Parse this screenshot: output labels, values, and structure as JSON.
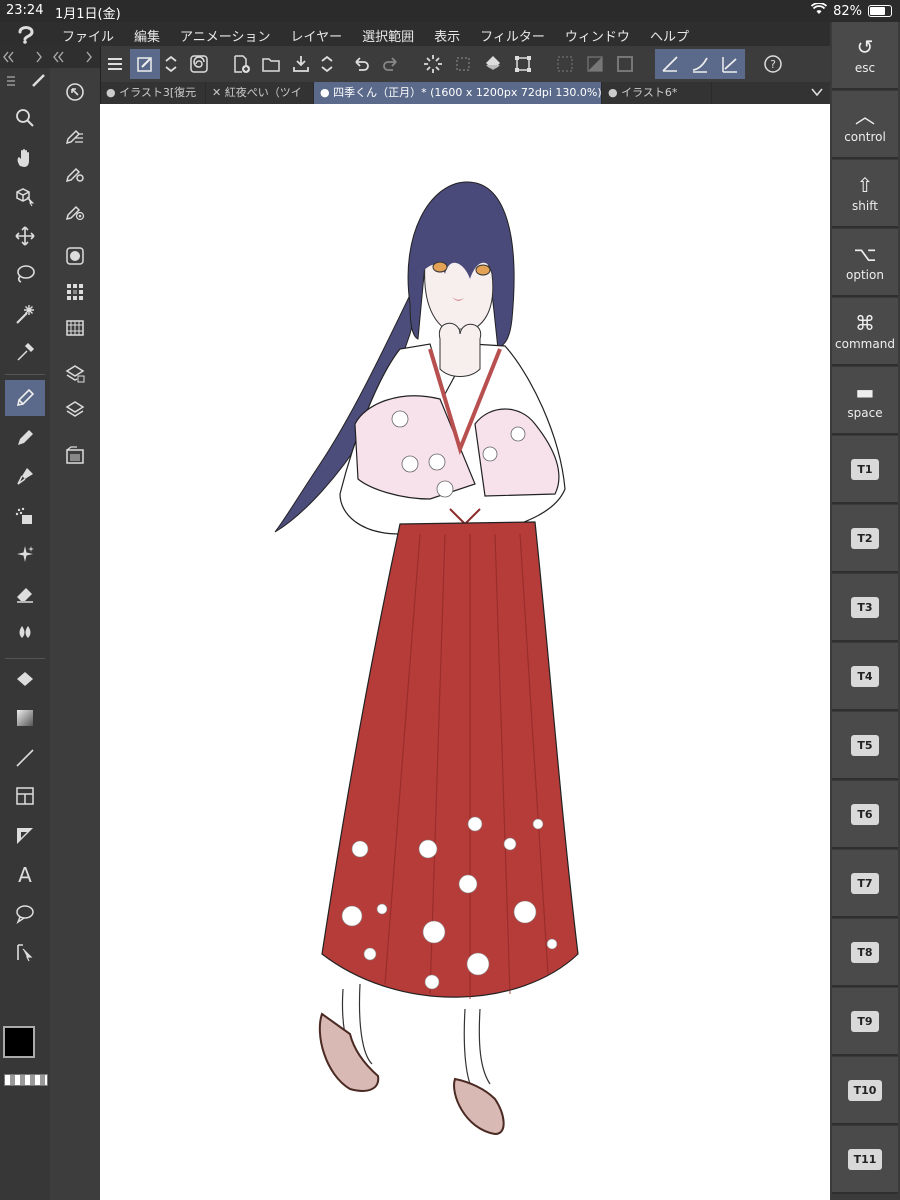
{
  "status": {
    "time": "23:24",
    "date": "1月1日(金)",
    "battery": "82%"
  },
  "menu": [
    "ファイル",
    "編集",
    "アニメーション",
    "レイヤー",
    "選択範囲",
    "表示",
    "フィルター",
    "ウィンドウ",
    "ヘルプ"
  ],
  "tabs": [
    {
      "label": "● イラスト3[復元",
      "active": false
    },
    {
      "label": "✕ 紅夜ぺい（ツイ",
      "active": false
    },
    {
      "label": "● 四季くん（正月）* (1600 x 1200px 72dpi 130.0%)",
      "active": true
    },
    {
      "label": "● イラスト6*",
      "active": false
    }
  ],
  "modifier_keys": [
    {
      "glyph": "↺",
      "label": "esc"
    },
    {
      "glyph": "︿",
      "label": "control"
    },
    {
      "glyph": "⇧",
      "label": "shift"
    },
    {
      "glyph": "⌥",
      "label": "option"
    },
    {
      "glyph": "⌘",
      "label": "command"
    },
    {
      "glyph": "▬",
      "label": "space"
    }
  ],
  "function_keys": [
    "T1",
    "T2",
    "T3",
    "T4",
    "T5",
    "T6",
    "T7",
    "T8",
    "T9",
    "T10",
    "T11"
  ],
  "colors": {
    "main": "#000000",
    "sub": "#ffffff",
    "accent": "#5b6a8a"
  }
}
